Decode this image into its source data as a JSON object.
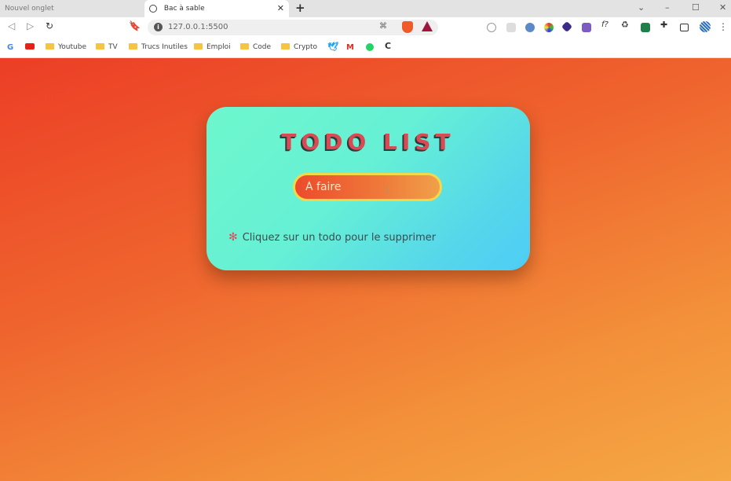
{
  "browser": {
    "inactive_tab_label": "Nouvel onglet",
    "active_tab_label": "Bac à sable",
    "tab_close_glyph": "✕",
    "new_tab_glyph": "+",
    "address_url": "127.0.0.1:5500",
    "window_controls": [
      "⌄",
      "–",
      "☐",
      "✕"
    ],
    "menu_glyph": "⋮"
  },
  "bookmarks": [
    {
      "label": "Youtube"
    },
    {
      "label": "TV"
    },
    {
      "label": "Trucs Inutiles"
    },
    {
      "label": "Emploi"
    },
    {
      "label": "Code"
    },
    {
      "label": "Crypto"
    }
  ],
  "page": {
    "title": "TODO LIST",
    "input_placeholder": "À faire",
    "hint_star": "✻",
    "hint_text": "Cliquez sur un todo pour le supprimer"
  },
  "colors": {
    "background_start": "#ec3e26",
    "background_end": "#f5a845",
    "card_start": "#6ef7cc",
    "card_end": "#4ecdf5",
    "title": "#d94a52",
    "input_border": "#f5d84a"
  }
}
